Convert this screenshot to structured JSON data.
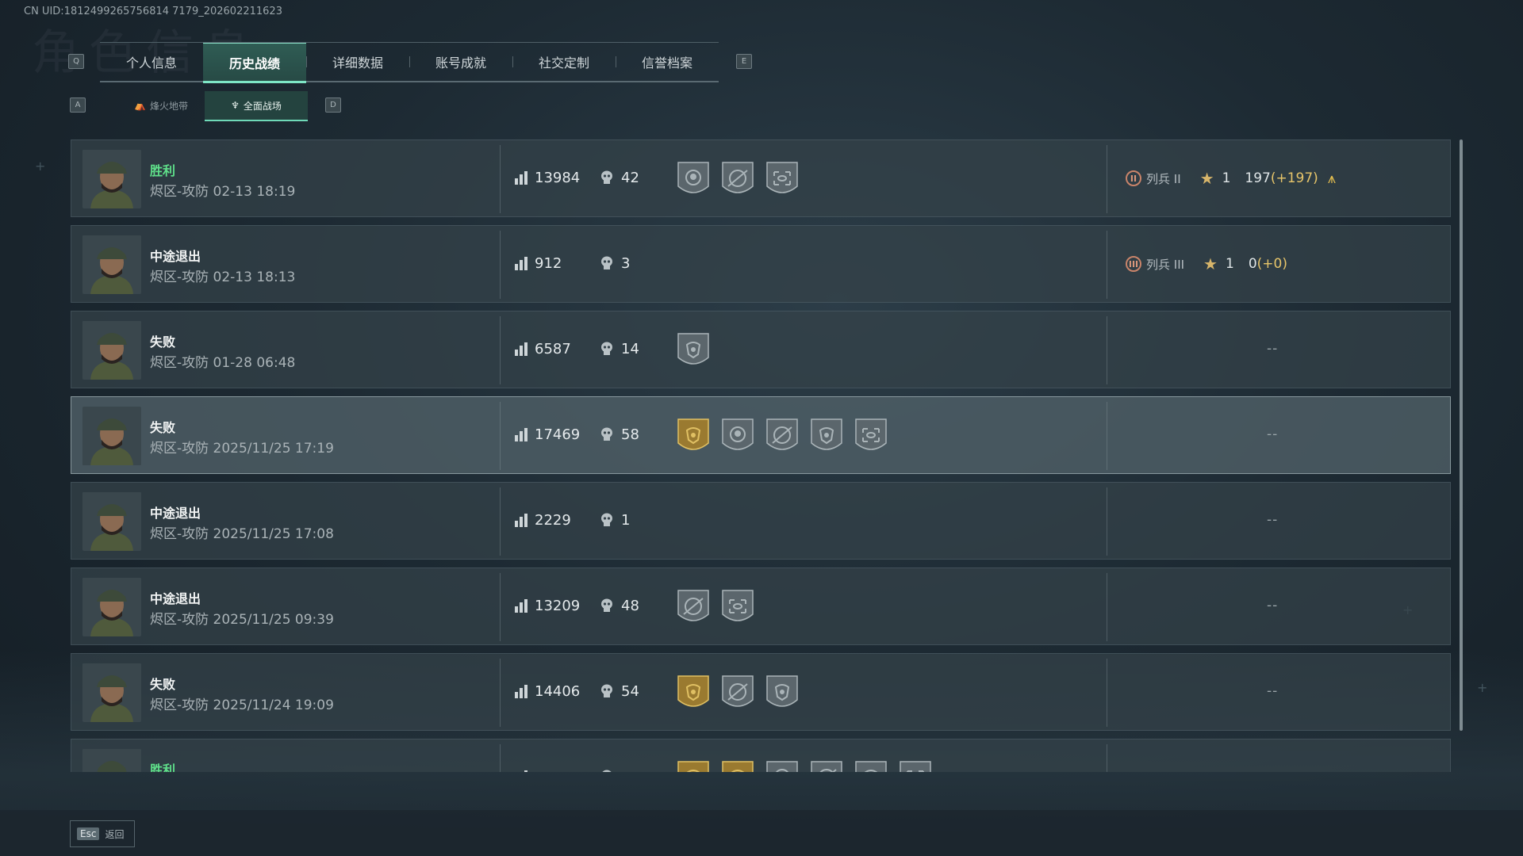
{
  "header": {
    "uid": "CN UID:1812499265756814 7179_202602211623",
    "tabs": [
      "个人信息",
      "历史战绩",
      "详细数据",
      "账号成就",
      "社交定制",
      "信誉档案"
    ],
    "active_tab": "历史战绩",
    "key_prev": "Q",
    "key_next": "E"
  },
  "subtabs": {
    "items": [
      "烽火地带",
      "全面战场"
    ],
    "active": "全面战场",
    "key_prev": "A",
    "key_next": "D"
  },
  "matches": [
    {
      "result": "胜利",
      "win": true,
      "mode": "烬区-攻防 02-13 18:19",
      "score": "13984",
      "kills": "42",
      "medals": [
        "skull-emblem",
        "crosshair-emblem",
        "scope-emblem"
      ],
      "rank": {
        "roman": "II",
        "name": "列兵 II",
        "stars": "1",
        "xp": "197",
        "xp_gain": "(+197)",
        "promotion": true
      }
    },
    {
      "result": "中途退出",
      "win": false,
      "mode": "烬区-攻防 02-13 18:13",
      "score": "912",
      "kills": "3",
      "medals": [],
      "rank": {
        "roman": "III",
        "name": "列兵 III",
        "stars": "1",
        "xp": "0",
        "xp_gain": "(+0)",
        "promotion": false
      }
    },
    {
      "result": "失败",
      "win": false,
      "mode": "烬区-攻防 01-28 06:48",
      "score": "6587",
      "kills": "14",
      "medals": [
        "eagle-emblem"
      ],
      "rank": null,
      "placeholder": "--"
    },
    {
      "result": "失败",
      "win": false,
      "mode": "烬区-攻防 2025/11/25 17:19",
      "score": "17469",
      "kills": "58",
      "medals": [
        "gold-eagle-emblem",
        "skull-emblem",
        "crosshair-emblem",
        "eagle-emblem",
        "scope-emblem"
      ],
      "rank": null,
      "placeholder": "--"
    },
    {
      "result": "中途退出",
      "win": false,
      "mode": "烬区-攻防 2025/11/25 17:08",
      "score": "2229",
      "kills": "1",
      "medals": [],
      "rank": null,
      "placeholder": "--"
    },
    {
      "result": "中途退出",
      "win": false,
      "mode": "烬区-攻防 2025/11/25 09:39",
      "score": "13209",
      "kills": "48",
      "medals": [
        "crosshair-emblem",
        "scope-emblem"
      ],
      "rank": null,
      "placeholder": "--"
    },
    {
      "result": "失败",
      "win": false,
      "mode": "烬区-攻防 2025/11/24 19:09",
      "score": "14406",
      "kills": "54",
      "medals": [
        "gold-eagle-emblem",
        "crosshair-emblem",
        "eagle-emblem"
      ],
      "rank": null,
      "placeholder": "--"
    },
    {
      "result": "胜利",
      "win": true,
      "mode": "",
      "score": "",
      "kills": "",
      "medals": [
        "gold-eagle-emblem",
        "gold-eagle-emblem",
        "skull-emblem",
        "crosshair-emblem",
        "eagle-emblem",
        "scope-emblem"
      ],
      "rank": null,
      "placeholder": ""
    }
  ],
  "footer": {
    "esc_key": "Esc",
    "back_label": "返回"
  },
  "colors": {
    "accent": "#7ee6c6",
    "win": "#5fe08a",
    "gold": "#e7c56a"
  }
}
